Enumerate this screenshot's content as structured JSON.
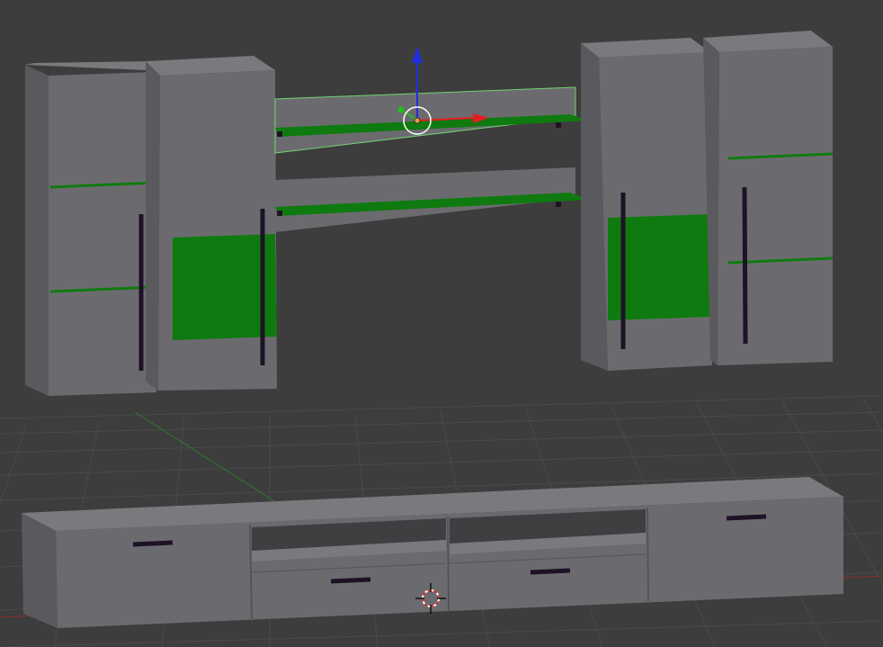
{
  "viewport": {
    "name": "3D Viewport",
    "background": "#3d3d3d",
    "grid_color": "#4a4a4a",
    "axis_x_color": "#b03030",
    "axis_y_color": "#2e8b2e"
  },
  "palette": {
    "body_front": "#6b6b6f",
    "body_side": "#59595d",
    "body_top": "#78787c",
    "accent_green": "#0f7a0f",
    "handle": "#1e1226",
    "selection_outline": "#6fd36f"
  },
  "scene": {
    "objects": [
      "tall-cabinet-left-outer",
      "tall-cabinet-left-inner",
      "wall-shelf-upper",
      "wall-shelf-lower",
      "tall-cabinet-right-inner",
      "tall-cabinet-right-outer",
      "tv-stand"
    ],
    "selected": "wall-shelf-upper"
  },
  "gizmo": {
    "x_axis_color": "#e02020",
    "y_axis_color": "#20c020",
    "z_axis_color": "#1f2fe0"
  }
}
